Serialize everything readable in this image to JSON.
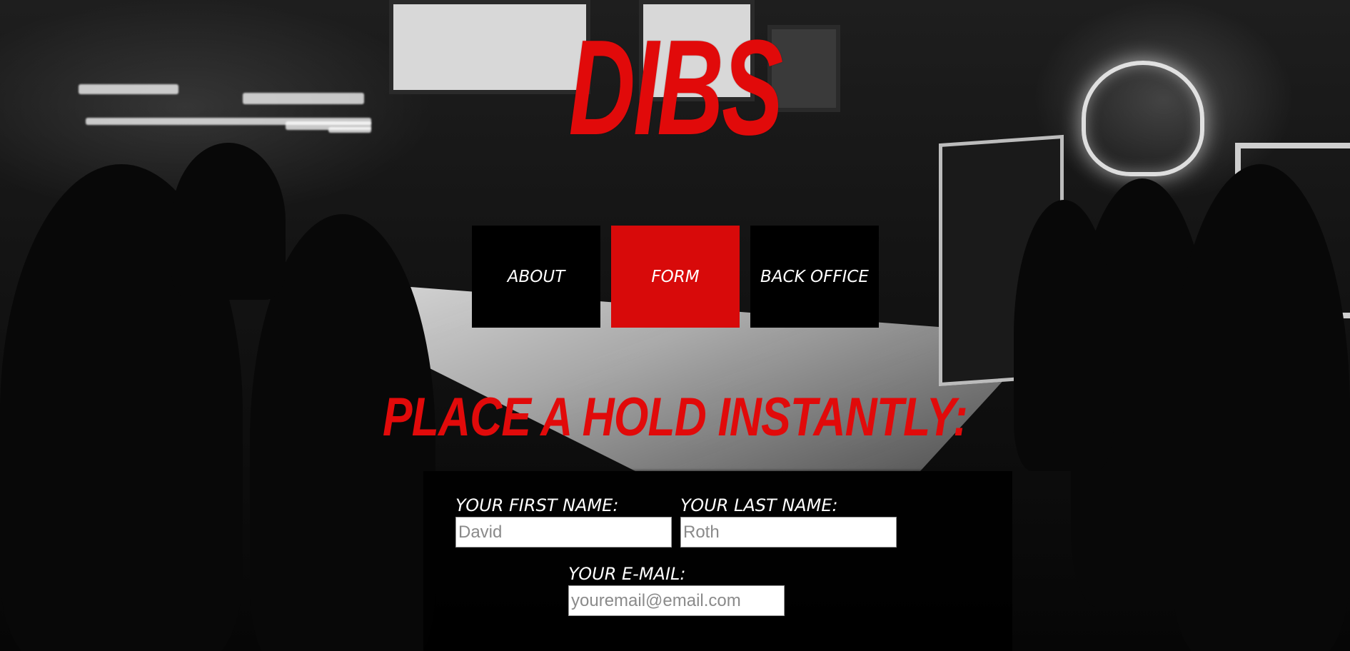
{
  "brand": {
    "logo_text": "DIBS",
    "accent_color": "#e10a0a"
  },
  "nav": {
    "items": [
      {
        "label": "ABOUT",
        "active": false
      },
      {
        "label": "FORM",
        "active": true
      },
      {
        "label": "BACK OFFICE",
        "active": false
      }
    ]
  },
  "headline": "PLACE A HOLD INSTANTLY:",
  "form": {
    "first_name": {
      "label": "YOUR FIRST NAME:",
      "placeholder": "David"
    },
    "last_name": {
      "label": "YOUR LAST NAME:",
      "placeholder": "Roth"
    },
    "email": {
      "label": "YOUR E-MAIL:",
      "placeholder": "youremail@email.com"
    }
  },
  "background": {
    "description_icon": "bar-photo"
  }
}
